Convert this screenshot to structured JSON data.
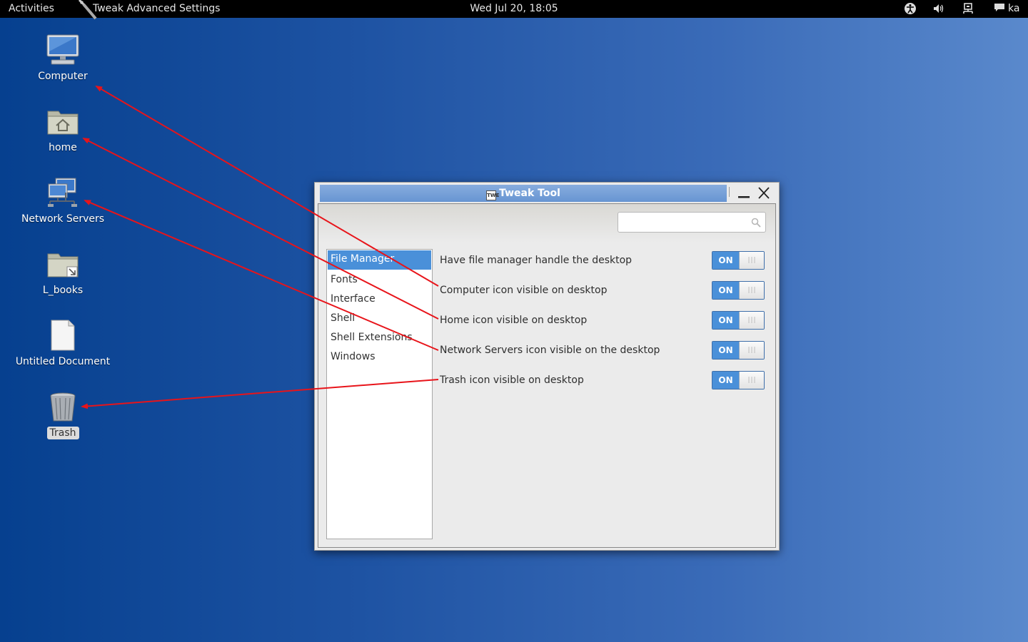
{
  "topbar": {
    "activities": "Activities",
    "app_name": "Tweak Advanced Settings",
    "clock": "Wed Jul 20, 18:05",
    "user": "ka",
    "tray_icons": [
      "accessibility-icon",
      "volume-icon",
      "network-wired-icon",
      "chat-icon"
    ]
  },
  "desktop": {
    "icons": [
      {
        "label": "Computer",
        "icon": "computer-icon"
      },
      {
        "label": "home",
        "icon": "home-folder-icon"
      },
      {
        "label": "Network Servers",
        "icon": "network-servers-icon"
      },
      {
        "label": "L_books",
        "icon": "folder-link-icon"
      },
      {
        "label": "Untitled Document",
        "icon": "document-icon"
      },
      {
        "label": "Trash",
        "icon": "trash-icon",
        "selected": true
      }
    ]
  },
  "window": {
    "title": "Tweak Tool",
    "title_icon_text": "TWE",
    "search": {
      "value": "",
      "placeholder": ""
    },
    "sidebar": {
      "items": [
        {
          "label": "File Manager",
          "active": true
        },
        {
          "label": "Fonts"
        },
        {
          "label": "Interface"
        },
        {
          "label": "Shell"
        },
        {
          "label": "Shell Extensions"
        },
        {
          "label": "Windows"
        }
      ]
    },
    "settings": [
      {
        "label": "Have file manager handle the desktop",
        "state": "ON"
      },
      {
        "label": "Computer icon visible on desktop",
        "state": "ON"
      },
      {
        "label": "Home icon visible on desktop",
        "state": "ON"
      },
      {
        "label": "Network Servers icon visible on the desktop",
        "state": "ON"
      },
      {
        "label": "Trash icon visible on desktop",
        "state": "ON"
      }
    ]
  },
  "colors": {
    "selection": "#4a90d9",
    "annotation_arrow": "#e8141a",
    "titlebar": "#6f9ad4"
  }
}
